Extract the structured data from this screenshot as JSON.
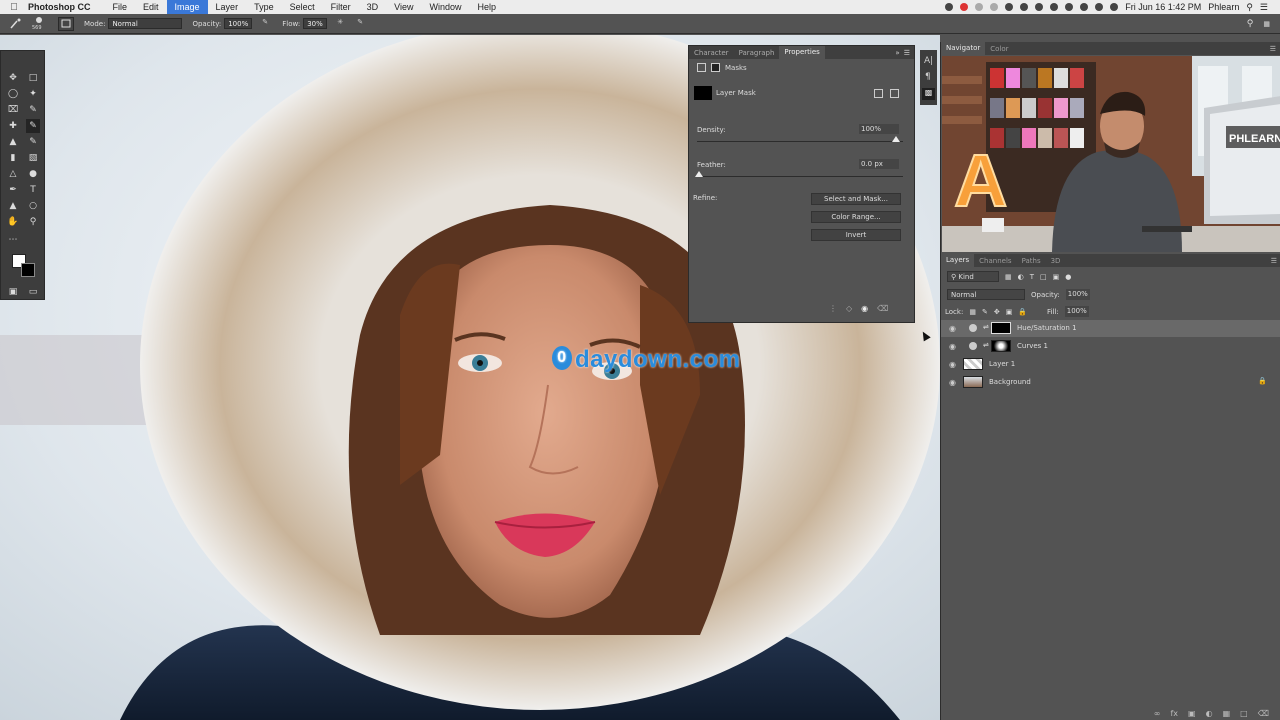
{
  "menubar": {
    "app_name": "Photoshop CC",
    "menus": [
      "File",
      "Edit",
      "Image",
      "Layer",
      "Type",
      "Select",
      "Filter",
      "3D",
      "View",
      "Window",
      "Help"
    ],
    "active_menu": "Image",
    "clock": "Fri Jun 16  1:42 PM",
    "user": "Phlearn"
  },
  "options": {
    "brush_size": "569",
    "mode_label": "Mode:",
    "mode_value": "Normal",
    "opacity_label": "Opacity:",
    "opacity_value": "100%",
    "flow_label": "Flow:",
    "flow_value": "30%"
  },
  "properties": {
    "tabs": [
      "Character",
      "Paragraph",
      "Properties"
    ],
    "active_tab": "Properties",
    "section": "Masks",
    "mask_type": "Layer Mask",
    "density_label": "Density:",
    "density_value": "100%",
    "feather_label": "Feather:",
    "feather_value": "0.0 px",
    "refine_label": "Refine:",
    "btn_select_mask": "Select and Mask...",
    "btn_color_range": "Color Range...",
    "btn_invert": "Invert"
  },
  "navigator": {
    "tabs": [
      "Navigator",
      "Color"
    ],
    "active_tab": "Navigator"
  },
  "layers_panel": {
    "tabs": [
      "Layers",
      "Channels",
      "Paths",
      "3D"
    ],
    "active_tab": "Layers",
    "kind_label": "Kind",
    "blend_mode": "Normal",
    "opacity_label": "Opacity:",
    "opacity_value": "100%",
    "lock_label": "Lock:",
    "fill_label": "Fill:",
    "fill_value": "100%",
    "layers": [
      {
        "name": "Hue/Saturation 1",
        "selected": true
      },
      {
        "name": "Curves 1",
        "selected": false
      },
      {
        "name": "Layer 1",
        "selected": false
      },
      {
        "name": "Background",
        "selected": false
      }
    ]
  },
  "watermark": {
    "text": "daydown.com",
    "badge": "0"
  },
  "video": {
    "sign_text": "PHLEARN",
    "big_letter": "A"
  },
  "colors": {
    "accent": "#3a78d8",
    "panel": "#535353",
    "panel_dark": "#3d3d3d"
  }
}
